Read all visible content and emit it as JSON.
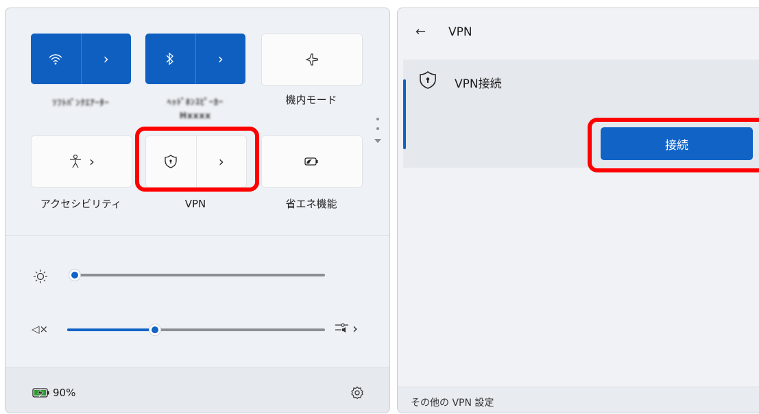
{
  "quick_settings": {
    "tiles": [
      {
        "id": "wifi",
        "label": "ｿﾌﾄﾊﾞﾝｸｴｱｰﾀｰ",
        "icon": "wifi-icon",
        "state": "on"
      },
      {
        "id": "bluetooth",
        "label": "ﾍｯﾄﾞﾎﾝｽﾋﾟｰｶｰ",
        "label2": "Hxxxx",
        "icon": "bluetooth-icon",
        "state": "on"
      },
      {
        "id": "airplane",
        "label": "機内モード",
        "icon": "airplane-icon",
        "state": "off"
      },
      {
        "id": "accessibility",
        "label": "アクセシビリティ",
        "icon": "accessibility-icon",
        "state": "off"
      },
      {
        "id": "vpn",
        "label": "VPN",
        "icon": "shield-icon",
        "state": "off"
      },
      {
        "id": "battery_saver",
        "label": "省エネ機能",
        "icon": "battery-saver-icon",
        "state": "off"
      }
    ],
    "brightness": {
      "icon": "sun-icon",
      "value": 0.0
    },
    "volume": {
      "icon": "speaker-muted-icon",
      "value": 0.33,
      "mute_mark": "×",
      "output_icon": "audio-output-icon"
    },
    "battery": {
      "percent": "90%",
      "icon": "battery-charging-icon"
    },
    "settings_icon": "gear-icon"
  },
  "vpn_panel": {
    "back_arrow": "←",
    "title": "VPN",
    "connection_name": "VPN接続",
    "connect_label": "接続",
    "more_settings": "その他の VPN 設定"
  },
  "highlight_color": "#ff0000",
  "accent_color": "#1163c6"
}
